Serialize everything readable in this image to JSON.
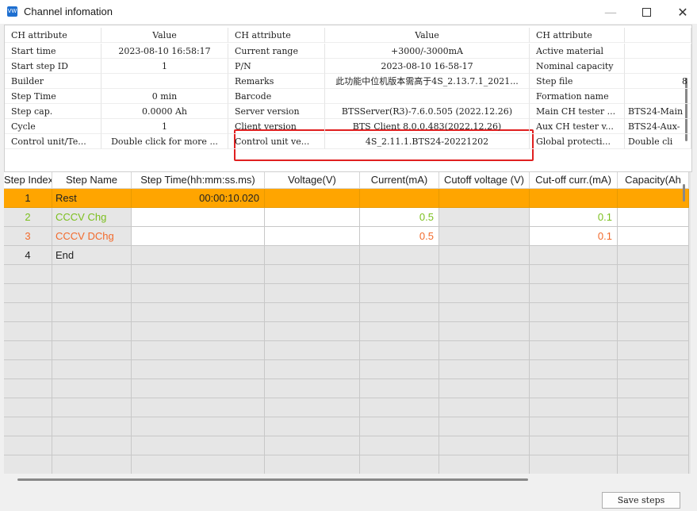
{
  "window": {
    "title": "Channel infomation",
    "icon_text": "VW",
    "icon_name": "app-icon"
  },
  "info": {
    "rows": [
      [
        "CH attribute",
        "Value",
        "CH attribute",
        "Value",
        "CH attribute",
        ""
      ],
      [
        "Start time",
        "2023-08-10 16:58:17",
        "Current range",
        "+3000/-3000mA",
        "Active material",
        ""
      ],
      [
        "Start step ID",
        "1",
        "P/N",
        "2023-08-10 16-58-17",
        "Nominal capacity",
        ""
      ],
      [
        "Builder",
        "",
        "Remarks",
        "此功能中位机版本需高于4S_2.13.7.1_2021...",
        "Step file",
        "8"
      ],
      [
        "Step Time",
        "0 min",
        "Barcode",
        "",
        "Formation name",
        ""
      ],
      [
        "Step cap.",
        "0.0000 Ah",
        "Server version",
        "BTSServer(R3)-7.6.0.505 (2022.12.26)",
        "Main CH tester ...",
        "BTS24-Main"
      ],
      [
        "Cycle",
        "1",
        "Client version",
        "BTS Client 8.0.0.483(2022.12.26)",
        "Aux CH tester v...",
        "BTS24-Aux-"
      ],
      [
        "Control unit/Te...",
        "Double click for more ...",
        "Control unit ve...",
        "4S_2.11.1.BTS24-20221202",
        "Global protecti...",
        "Double cli"
      ]
    ]
  },
  "steps": {
    "headers": [
      "Step Index",
      "Step Name",
      "Step Time(hh:mm:ss.ms)",
      "Voltage(V)",
      "Current(mA)",
      "Cutoff voltage (V)",
      "Cut-off curr.(mA)",
      "Capacity(Ah"
    ],
    "rows": [
      {
        "idx": "1",
        "name": "Rest",
        "time": "00:00:10.020",
        "voltage": "",
        "current": "",
        "cutoff_v": "",
        "cutoff_i": "",
        "capacity": ""
      },
      {
        "idx": "2",
        "name": "CCCV Chg",
        "time": "",
        "voltage": "",
        "current": "0.5",
        "cutoff_v": "",
        "cutoff_i": "0.1",
        "capacity": ""
      },
      {
        "idx": "3",
        "name": "CCCV DChg",
        "time": "",
        "voltage": "",
        "current": "0.5",
        "cutoff_v": "",
        "cutoff_i": "0.1",
        "capacity": ""
      },
      {
        "idx": "4",
        "name": "End",
        "time": "",
        "voltage": "",
        "current": "",
        "cutoff_v": "",
        "cutoff_i": "",
        "capacity": ""
      }
    ],
    "empty_rows": 11
  },
  "buttons": {
    "save": "Save steps"
  },
  "colors": {
    "selected": "#ffa500",
    "charge": "#7bbf1e",
    "discharge": "#f26a2c",
    "highlight_box": "#e02020"
  }
}
